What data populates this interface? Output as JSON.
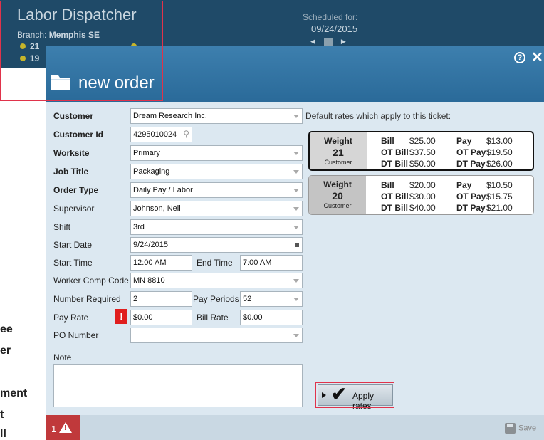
{
  "background": {
    "title": "Labor Dispatcher",
    "branch_label": "Branch:",
    "branch_value": "Memphis SE",
    "stat_a": "21",
    "stat_b": "19",
    "scheduled_label": "Scheduled for:",
    "scheduled_date": "09/24/2015",
    "left_fragments": [
      "ee",
      "er",
      "ment",
      "t",
      "ll"
    ]
  },
  "modal": {
    "title": "new order",
    "help_icon": "help-circle-icon",
    "close_icon": "close-icon"
  },
  "form": {
    "customer": {
      "label": "Customer",
      "value": "Dream Research Inc."
    },
    "customer_id": {
      "label": "Customer Id",
      "value": "4295010024"
    },
    "worksite": {
      "label": "Worksite",
      "value": "Primary"
    },
    "job_title": {
      "label": "Job Title",
      "value": "Packaging"
    },
    "order_type": {
      "label": "Order Type",
      "value": "Daily Pay / Labor"
    },
    "supervisor": {
      "label": "Supervisor",
      "value": "Johnson, Neil"
    },
    "shift": {
      "label": "Shift",
      "value": "3rd"
    },
    "start_date": {
      "label": "Start Date",
      "value": "9/24/2015"
    },
    "start_time": {
      "label": "Start Time",
      "value": "12:00 AM"
    },
    "end_time": {
      "label": "End Time",
      "value": "7:00 AM"
    },
    "worker_comp": {
      "label": "Worker Comp Code",
      "value": "MN 8810"
    },
    "number_required": {
      "label": "Number Required",
      "value": "2"
    },
    "pay_periods": {
      "label": "Pay Periods",
      "value": "52"
    },
    "pay_rate": {
      "label": "Pay Rate",
      "value": "$0.00"
    },
    "bill_rate": {
      "label": "Bill Rate",
      "value": "$0.00"
    },
    "po_number": {
      "label": "PO Number",
      "value": ""
    },
    "note": {
      "label": "Note",
      "value": ""
    },
    "warning_mark": "!"
  },
  "rates": {
    "intro": "Default rates which apply to this ticket:",
    "cards": [
      {
        "title": "Weight",
        "number": "21",
        "kind": "Customer",
        "bill": "$25.00",
        "ot_bill": "$37.50",
        "dt_bill": "$50.00",
        "pay": "$13.00",
        "ot_pay": "$19.50",
        "dt_pay": "$26.00"
      },
      {
        "title": "Weight",
        "number": "20",
        "kind": "Customer",
        "bill": "$20.00",
        "ot_bill": "$30.00",
        "dt_bill": "$40.00",
        "pay": "$10.50",
        "ot_pay": "$15.75",
        "dt_pay": "$21.00"
      }
    ],
    "labels": {
      "bill": "Bill",
      "ot_bill": "OT Bill",
      "dt_bill": "DT Bill",
      "pay": "Pay",
      "ot_pay": "OT Pay",
      "dt_pay": "DT Pay"
    },
    "apply_label": "Apply rates"
  },
  "footer": {
    "error_count": "1",
    "save_label": "Save"
  }
}
